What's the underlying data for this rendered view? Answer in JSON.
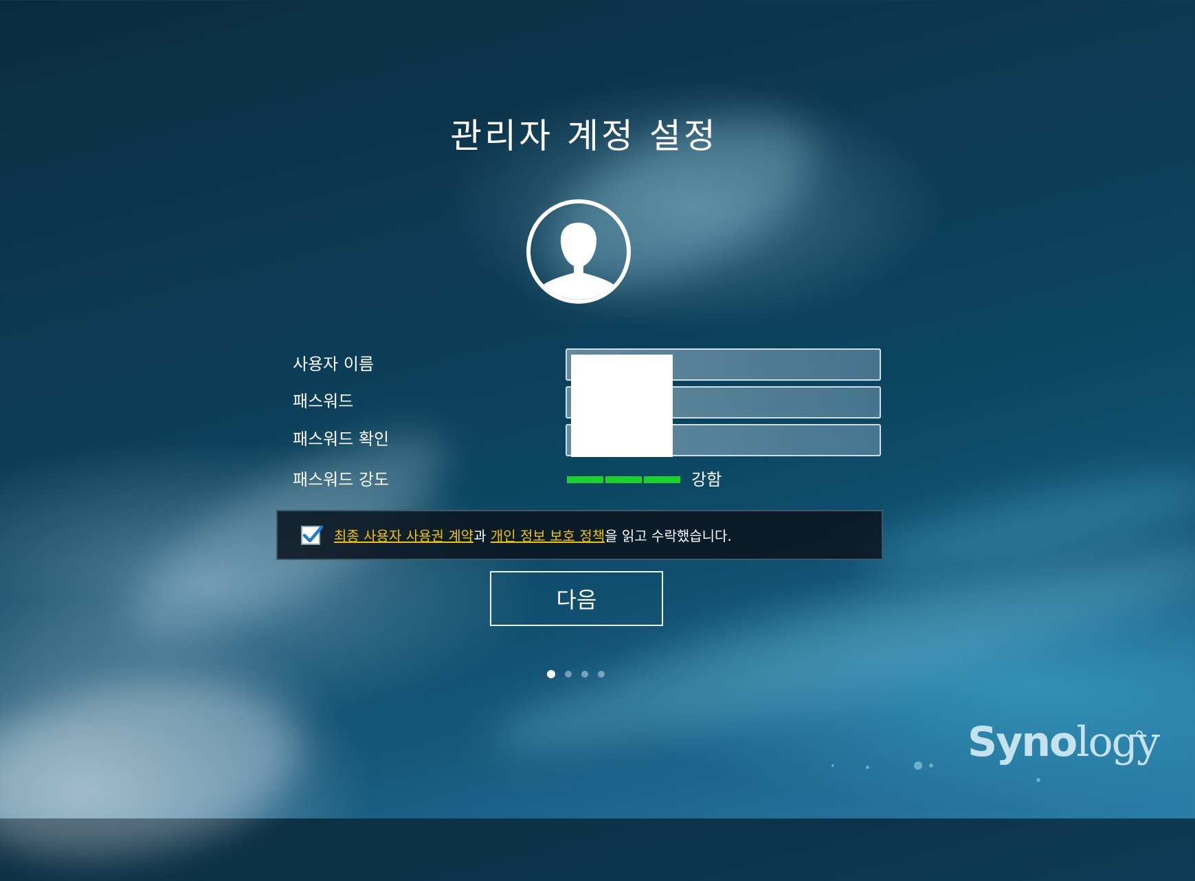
{
  "page": {
    "title": "관리자 계정 설정"
  },
  "form": {
    "username_label": "사용자 이름",
    "password_label": "패스워드",
    "confirm_label": "패스워드 확인",
    "strength_label": "패스워드 강도",
    "username_value": "",
    "password_value": "",
    "confirm_value": "",
    "strength": {
      "segments_filled": 3,
      "segments_total": 3,
      "text": "강함",
      "color": "#19d22a"
    }
  },
  "agreement": {
    "checked": true,
    "eula_link": "최종 사용자 사용권 계약",
    "joiner": "과 ",
    "privacy_link": "개인 정보 보호 정책",
    "suffix": "을 읽고 수락했습니다."
  },
  "buttons": {
    "next_label": "다음"
  },
  "steps": {
    "total": 4,
    "current": 1
  },
  "brand": {
    "logo_main": "Syno",
    "logo_tail": "logy",
    "link_color": "#f2c200"
  },
  "icons": {
    "avatar": "user-avatar-icon",
    "check": "checkmark-icon"
  }
}
